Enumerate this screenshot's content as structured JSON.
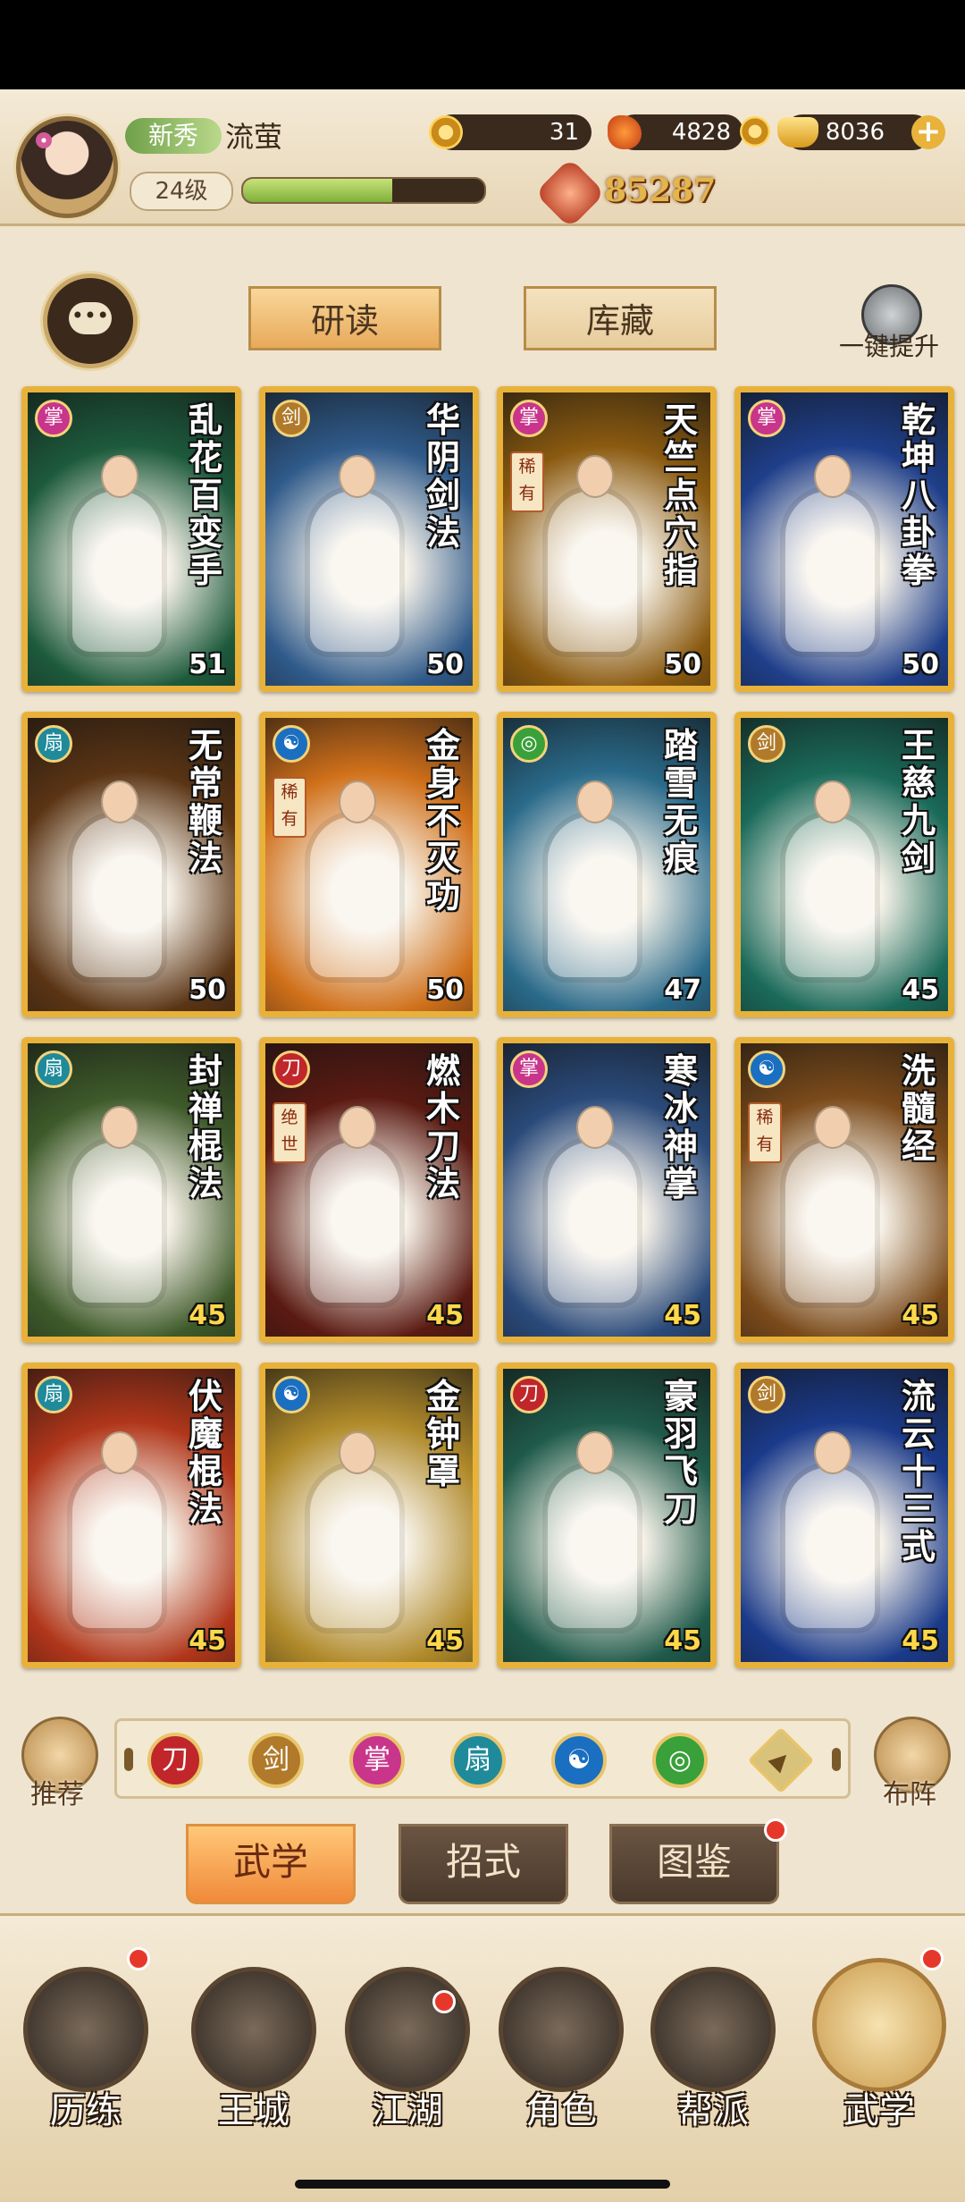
{
  "player": {
    "rank_badge": "新秀",
    "name": "流萤",
    "level": "24级",
    "exp_fraction": 0.62,
    "power": "85287"
  },
  "resources": {
    "coin": "31",
    "leaf": "4828",
    "gold": "8036"
  },
  "tabs": {
    "study": "研读",
    "store": "库藏",
    "one_key_upgrade": "一键提升"
  },
  "school_colors": {
    "blade": "#c0262a",
    "sword": "#b07a2a",
    "palm": "#c8358a",
    "fan": "#1f8a9a",
    "taiji": "#1a6fc0",
    "swirl": "#3aa03a",
    "up": "#d9c27a"
  },
  "cards": [
    {
      "title": "乱花百变手",
      "level": "51",
      "school": "palm",
      "tag": "",
      "bg": "#1d5a3c"
    },
    {
      "title": "华阴剑法",
      "level": "50",
      "school": "sword",
      "tag": "",
      "bg": "#2f5a8a"
    },
    {
      "title": "天竺点穴指",
      "level": "50",
      "school": "palm",
      "tag": "稀有",
      "bg": "#8a5a10"
    },
    {
      "title": "乾坤八卦拳",
      "level": "50",
      "school": "palm",
      "tag": "",
      "bg": "#1f3f8a"
    },
    {
      "title": "无常鞭法",
      "level": "50",
      "school": "fan",
      "tag": "",
      "bg": "#5a3414"
    },
    {
      "title": "金身不灭功",
      "level": "50",
      "school": "taiji",
      "tag": "稀有",
      "bg": "#d0701a"
    },
    {
      "title": "踏雪无痕",
      "level": "47",
      "school": "swirl",
      "tag": "",
      "bg": "#2a6a8a"
    },
    {
      "title": "王慈九剑",
      "level": "45",
      "school": "sword",
      "tag": "",
      "bg": "#1a6a5a"
    },
    {
      "title": "封禅棍法",
      "level": "45",
      "school": "fan",
      "tag": "",
      "bg": "#3e5a2a"
    },
    {
      "title": "燃木刀法",
      "level": "45",
      "school": "blade",
      "tag": "绝世",
      "bg": "#5a1a12"
    },
    {
      "title": "寒冰神掌",
      "level": "45",
      "school": "palm",
      "tag": "",
      "bg": "#2a4a7a"
    },
    {
      "title": "洗髓经",
      "level": "45",
      "school": "taiji",
      "tag": "稀有",
      "bg": "#7a4a1a"
    },
    {
      "title": "伏魔棍法",
      "level": "45",
      "school": "fan",
      "tag": "",
      "bg": "#b0361a"
    },
    {
      "title": "金钟罩",
      "level": "45",
      "school": "taiji",
      "tag": "",
      "bg": "#b08a2a"
    },
    {
      "title": "豪羽飞刀",
      "level": "45",
      "school": "blade",
      "tag": "",
      "bg": "#1f5a4a"
    },
    {
      "title": "流云十三式",
      "level": "45",
      "school": "sword",
      "tag": "",
      "bg": "#1a3a8a"
    }
  ],
  "filter": {
    "recommend": "推荐",
    "formation": "布阵",
    "icons": [
      "blade",
      "sword",
      "palm",
      "fan",
      "taiji",
      "swirl",
      "up"
    ]
  },
  "sub_tabs": {
    "martial": "武学",
    "moves": "招式",
    "atlas": "图鉴"
  },
  "nav": {
    "trial": "历练",
    "city": "王城",
    "jianghu": "江湖",
    "role": "角色",
    "guild": "帮派",
    "martial": "武学"
  }
}
